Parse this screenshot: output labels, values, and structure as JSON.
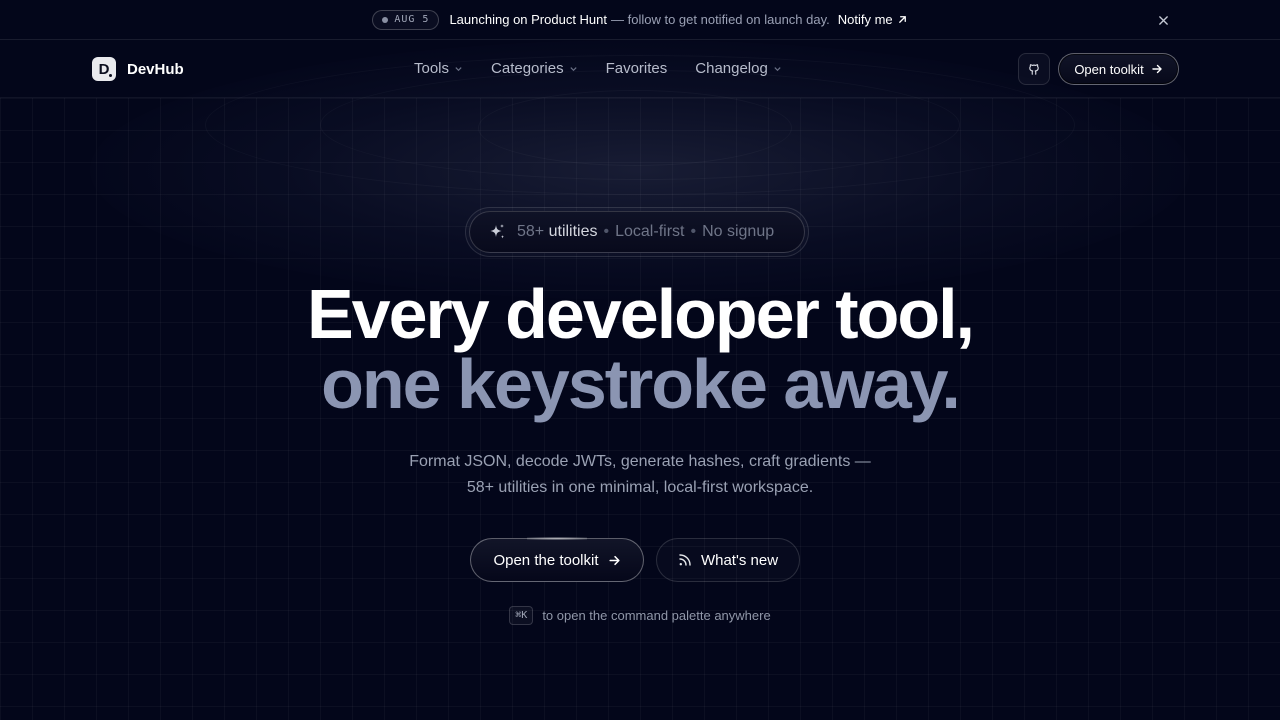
{
  "announcement": {
    "date": "AUG 5",
    "headline": "Launching on Product Hunt",
    "detail": "— follow to get notified on launch day.",
    "cta": "Notify me"
  },
  "nav": {
    "brand": "DevHub",
    "brand_mark": "D",
    "items": [
      {
        "label": "Tools",
        "has_dropdown": true
      },
      {
        "label": "Categories",
        "has_dropdown": true
      },
      {
        "label": "Favorites",
        "has_dropdown": false
      },
      {
        "label": "Changelog",
        "has_dropdown": true
      }
    ],
    "cta": "Open toolkit"
  },
  "hero": {
    "badge": {
      "count": "58+",
      "count_label": "utilities",
      "tag1": "Local-first",
      "tag2": "No signup",
      "separator": "•"
    },
    "title_line1": "Every developer tool,",
    "title_line2": "one keystroke away.",
    "subtitle_line1": "Format JSON, decode JWTs, generate hashes, craft gradients —",
    "subtitle_line2": "58+ utilities in one minimal, local-first workspace.",
    "primary_cta": "Open the toolkit",
    "secondary_cta": "What's new",
    "shortcut_key": "⌘K",
    "shortcut_hint": "to open the command palette anywhere"
  },
  "colors": {
    "background": "#03061a",
    "title": "#ffffff",
    "title_accent": "#8b95b2",
    "muted_text": "#9aa1b3"
  },
  "icons": [
    "close-icon",
    "arrow-up-right-icon",
    "github-icon",
    "arrow-right-icon",
    "sparkle-icon",
    "rss-icon",
    "chevron-down-icon"
  ]
}
